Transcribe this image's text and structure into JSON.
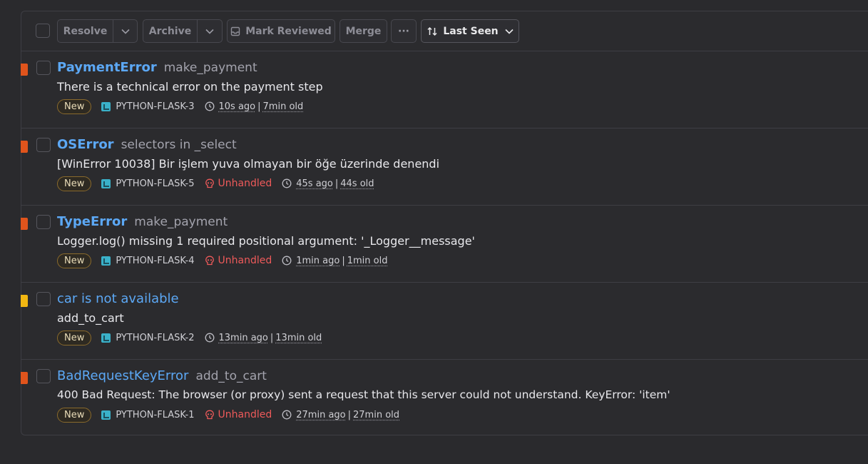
{
  "toolbar": {
    "resolve_label": "Resolve",
    "archive_label": "Archive",
    "mark_reviewed_label": "Mark Reviewed",
    "merge_label": "Merge",
    "more_label": "···",
    "sort_label": "Last Seen"
  },
  "colors": {
    "error": "#e0541c",
    "warning": "#f2b712",
    "link": "#5ca8f5",
    "unhandled": "#ee5a5a"
  },
  "issues": [
    {
      "type": "PaymentError",
      "culprit": "make_payment",
      "message": "There is a technical error on the payment step",
      "status": "New",
      "project": "PYTHON-FLASK-3",
      "unhandled": "",
      "last_seen": "10s ago",
      "age": "7min old",
      "level": "error"
    },
    {
      "type": "OSError",
      "culprit": "selectors in _select",
      "message": "[WinError 10038] Bir işlem yuva olmayan bir öğe üzerinde denendi",
      "status": "New",
      "project": "PYTHON-FLASK-5",
      "unhandled": "Unhandled",
      "last_seen": "45s ago",
      "age": "44s old",
      "level": "error"
    },
    {
      "type": "TypeError",
      "culprit": "make_payment",
      "message": "Logger.log() missing 1 required positional argument: '_Logger__message'",
      "status": "New",
      "project": "PYTHON-FLASK-4",
      "unhandled": "Unhandled",
      "last_seen": "1min ago",
      "age": "1min old",
      "level": "error"
    },
    {
      "type": "car is not available",
      "culprit": "",
      "message": "add_to_cart",
      "status": "New",
      "project": "PYTHON-FLASK-2",
      "unhandled": "",
      "last_seen": "13min ago",
      "age": "13min old",
      "level": "warning"
    },
    {
      "type": "BadRequestKeyError",
      "culprit": "add_to_cart",
      "message": "400 Bad Request: The browser (or proxy) sent a request that this server could not understand. KeyError: 'item'",
      "status": "New",
      "project": "PYTHON-FLASK-1",
      "unhandled": "Unhandled",
      "last_seen": "27min ago",
      "age": "27min old",
      "level": "error"
    }
  ]
}
